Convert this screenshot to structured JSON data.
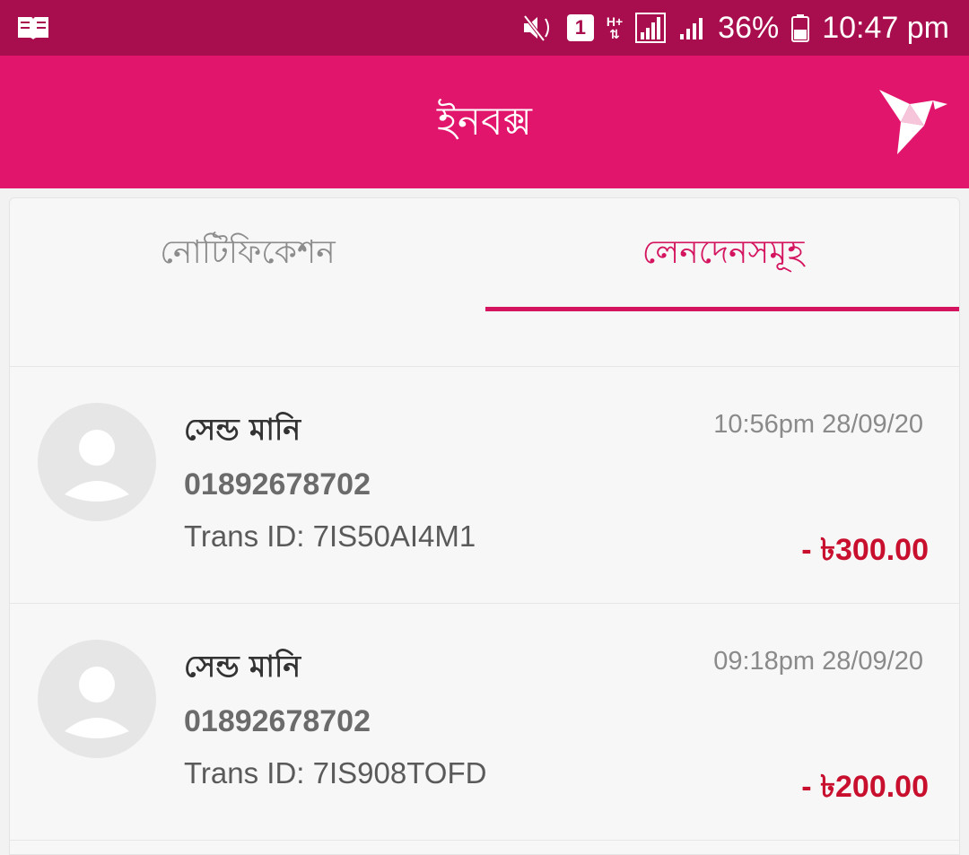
{
  "status_bar": {
    "battery": "36%",
    "time": "10:47 pm",
    "sim_slot": "1",
    "network_type": "H+"
  },
  "app_bar": {
    "title": "ইনবক্স"
  },
  "tabs": [
    {
      "label": "নোটিফিকেশন",
      "selected": false
    },
    {
      "label": "লেনদেনসমূহ",
      "selected": true
    }
  ],
  "transactions": [
    {
      "type": "সেন্ড মানি",
      "number": "01892678702",
      "trans_id_label": "Trans ID:",
      "trans_id": "7IS50AI4M1",
      "time": "10:56pm 28/09/20",
      "amount": "- ৳300.00"
    },
    {
      "type": "সেন্ড মানি",
      "number": "01892678702",
      "trans_id_label": "Trans ID:",
      "trans_id": "7IS908TOFD",
      "time": "09:18pm 28/09/20",
      "amount": "- ৳200.00"
    }
  ],
  "colors": {
    "status_bar": "#a80e4d",
    "app_bar": "#e2156d",
    "accent": "#d4145f",
    "amount": "#c8102e"
  }
}
